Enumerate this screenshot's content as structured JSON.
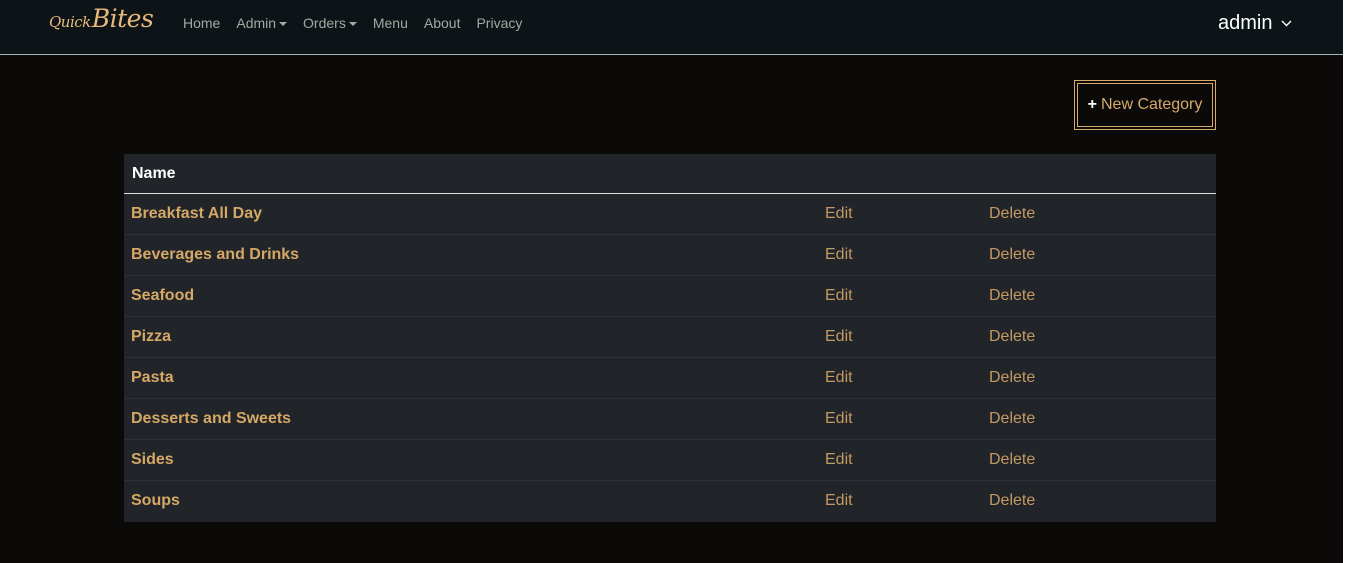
{
  "brand": {
    "part1": "Quick",
    "part2": "Bites"
  },
  "nav": {
    "home": "Home",
    "admin": "Admin",
    "orders": "Orders",
    "menu": "Menu",
    "about": "About",
    "privacy": "Privacy"
  },
  "user": {
    "name": "admin"
  },
  "actions": {
    "new_category": "New Category",
    "plus": "+"
  },
  "table": {
    "header_name": "Name",
    "edit_label": "Edit",
    "delete_label": "Delete",
    "rows": [
      "Breakfast All Day",
      "Beverages and Drinks",
      "Seafood",
      "Pizza",
      "Pasta",
      "Desserts and Sweets",
      "Sides",
      "Soups"
    ]
  },
  "colors": {
    "accent": "#d6a865",
    "navbar_bg": "#0c1417",
    "page_bg": "#0b0a09",
    "table_bg": "#212429"
  }
}
